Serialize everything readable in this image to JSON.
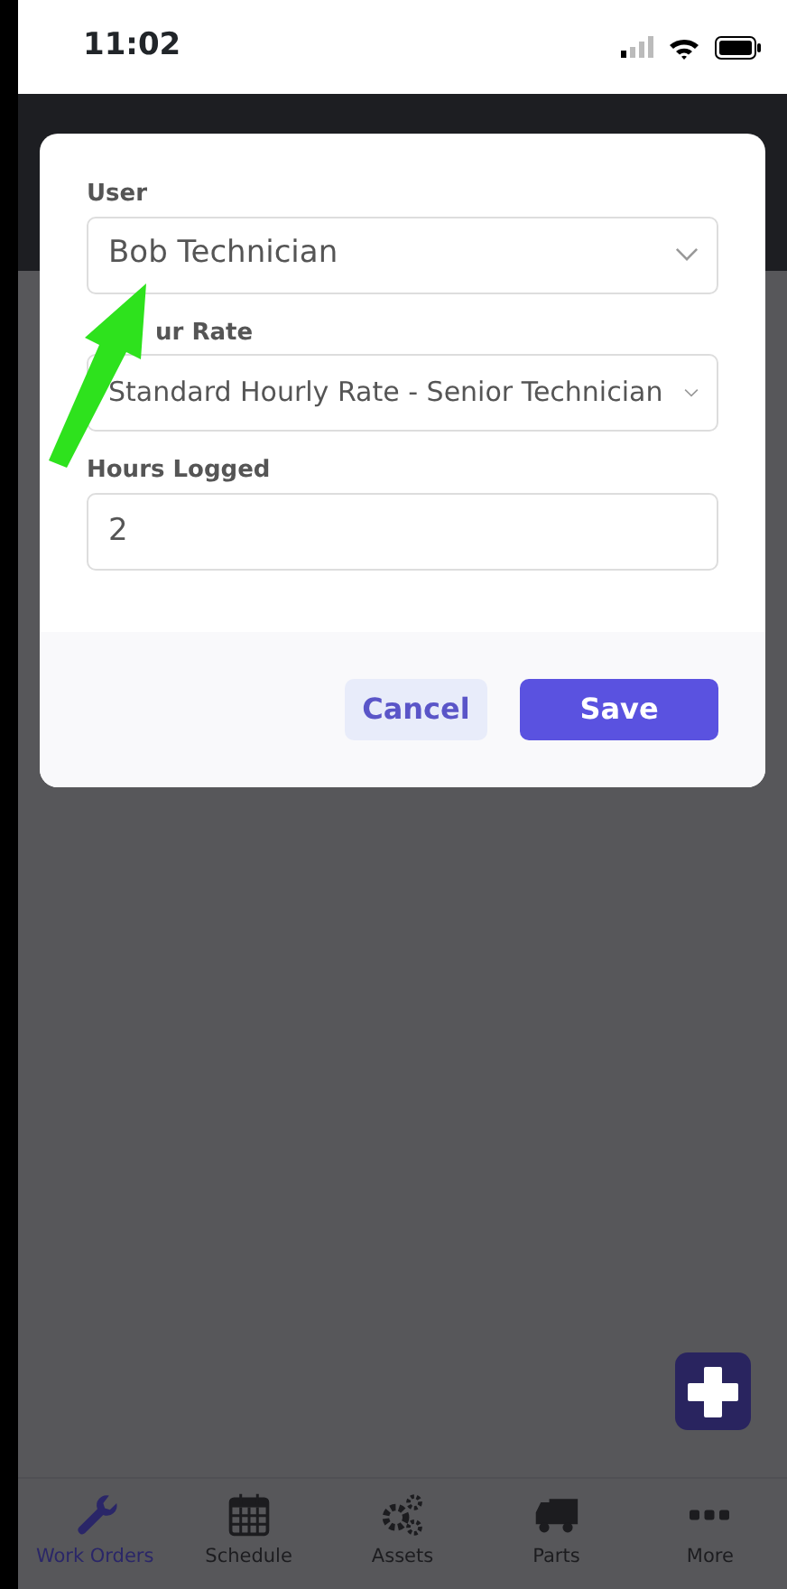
{
  "status_bar": {
    "time": "11:02"
  },
  "dialog": {
    "fields": [
      {
        "kind": "select",
        "label": "User",
        "value": "Bob Technician"
      },
      {
        "kind": "select",
        "label": "ur Rate",
        "value": "Standard Hourly Rate - Senior Technician"
      },
      {
        "kind": "input",
        "label": "Hours Logged",
        "value": "2"
      }
    ],
    "buttons": [
      {
        "kind": "secondary",
        "label": "Cancel"
      },
      {
        "kind": "primary",
        "label": "Save"
      }
    ]
  },
  "tab_bar": [
    {
      "label": "Work Orders",
      "selected": true
    },
    {
      "label": "Schedule",
      "selected": false
    },
    {
      "label": "Assets",
      "selected": false
    },
    {
      "label": "Parts",
      "selected": false
    },
    {
      "label": "More",
      "selected": false
    }
  ]
}
